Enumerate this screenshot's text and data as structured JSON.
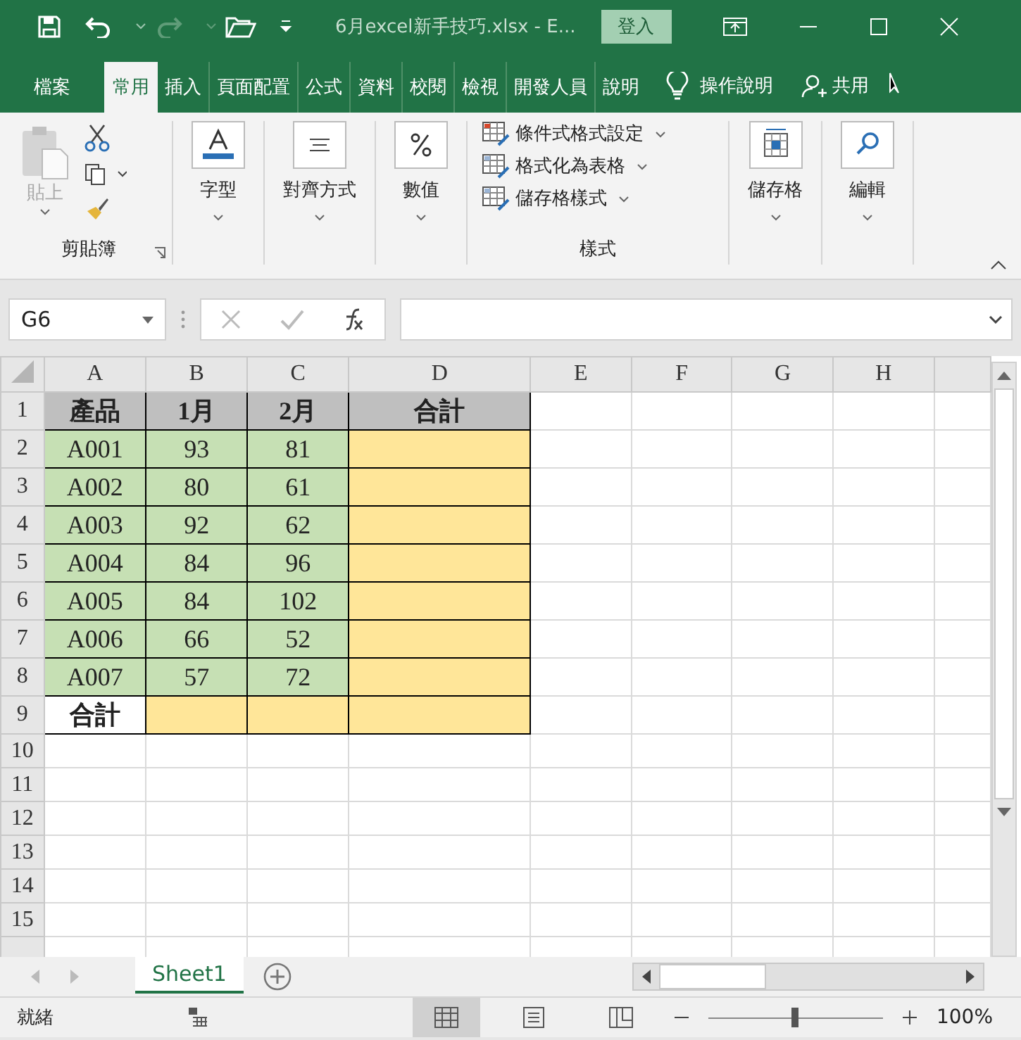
{
  "title_bar": {
    "title": "6月excel新手技巧.xlsx  -  E...",
    "sign_in": "登入"
  },
  "tabs": [
    {
      "label": "檔案",
      "selected": false
    },
    {
      "label": "常用",
      "selected": true
    },
    {
      "label": "插入",
      "selected": false
    },
    {
      "label": "頁面配置",
      "selected": false
    },
    {
      "label": "公式",
      "selected": false
    },
    {
      "label": "資料",
      "selected": false
    },
    {
      "label": "校閱",
      "selected": false
    },
    {
      "label": "檢視",
      "selected": false
    },
    {
      "label": "開發人員",
      "selected": false
    },
    {
      "label": "說明",
      "selected": false
    }
  ],
  "tell_me": "操作說明",
  "share": "共用",
  "ribbon": {
    "clipboard": {
      "paste": "貼上",
      "label": "剪貼簿"
    },
    "font": "字型",
    "alignment": "對齊方式",
    "number": "數值",
    "styles": {
      "items": [
        "條件式格式設定",
        "格式化為表格",
        "儲存格樣式"
      ],
      "label": "樣式"
    },
    "cells": "儲存格",
    "editing": "編輯"
  },
  "formula_bar": {
    "name_box": "G6"
  },
  "grid": {
    "columns": [
      "A",
      "B",
      "C",
      "D",
      "E",
      "F",
      "G",
      "H"
    ],
    "rows": [
      {
        "number": "1",
        "cells": [
          {
            "text": "產品",
            "color": "#bfbfbf",
            "bold": true
          },
          {
            "text": "1月",
            "color": "#bfbfbf",
            "bold": true
          },
          {
            "text": "2月",
            "color": "#bfbfbf",
            "bold": true
          },
          {
            "text": "合計",
            "color": "#bfbfbf",
            "bold": true
          }
        ]
      },
      {
        "number": "2",
        "cells": [
          {
            "text": "A001",
            "color": "#c6e0b4",
            "bold": false
          },
          {
            "text": "93",
            "color": "#c6e0b4",
            "bold": false
          },
          {
            "text": "81",
            "color": "#c6e0b4",
            "bold": false
          },
          {
            "color": "#ffe699"
          }
        ]
      },
      {
        "number": "3",
        "cells": [
          {
            "text": "A002",
            "color": "#c6e0b4",
            "bold": false
          },
          {
            "text": "80",
            "color": "#c6e0b4",
            "bold": false
          },
          {
            "text": "61",
            "color": "#c6e0b4",
            "bold": false
          },
          {
            "color": "#ffe699"
          }
        ]
      },
      {
        "number": "4",
        "cells": [
          {
            "text": "A003",
            "color": "#c6e0b4",
            "bold": false
          },
          {
            "text": "92",
            "color": "#c6e0b4",
            "bold": false
          },
          {
            "text": "62",
            "color": "#c6e0b4",
            "bold": false
          },
          {
            "color": "#ffe699"
          }
        ]
      },
      {
        "number": "5",
        "cells": [
          {
            "text": "A004",
            "color": "#c6e0b4",
            "bold": false
          },
          {
            "text": "84",
            "color": "#c6e0b4",
            "bold": false
          },
          {
            "text": "96",
            "color": "#c6e0b4",
            "bold": false
          },
          {
            "color": "#ffe699"
          }
        ]
      },
      {
        "number": "6",
        "cells": [
          {
            "text": "A005",
            "color": "#c6e0b4",
            "bold": false
          },
          {
            "text": "84",
            "color": "#c6e0b4",
            "bold": false
          },
          {
            "text": "102",
            "color": "#c6e0b4",
            "bold": false
          },
          {
            "color": "#ffe699"
          }
        ]
      },
      {
        "number": "7",
        "cells": [
          {
            "text": "A006",
            "color": "#c6e0b4",
            "bold": false
          },
          {
            "text": "66",
            "color": "#c6e0b4",
            "bold": false
          },
          {
            "text": "52",
            "color": "#c6e0b4",
            "bold": false
          },
          {
            "color": "#ffe699"
          }
        ]
      },
      {
        "number": "8",
        "cells": [
          {
            "text": "A007",
            "color": "#c6e0b4",
            "bold": false
          },
          {
            "text": "57",
            "color": "#c6e0b4",
            "bold": false
          },
          {
            "text": "72",
            "color": "#c6e0b4",
            "bold": false
          },
          {
            "color": "#ffe699"
          }
        ]
      },
      {
        "number": "9",
        "cells": [
          {
            "text": "合計",
            "color": "#ffffff",
            "bold": true
          },
          {
            "color": "#ffe699"
          },
          {
            "color": "#ffe699"
          },
          {
            "color": "#ffe699"
          }
        ]
      },
      {
        "number": "10",
        "cells": []
      },
      {
        "number": "11",
        "cells": []
      },
      {
        "number": "12",
        "cells": []
      },
      {
        "number": "13",
        "cells": []
      },
      {
        "number": "14",
        "cells": []
      },
      {
        "number": "15",
        "cells": []
      }
    ]
  },
  "sheet_tabs": [
    {
      "label": "Sheet1",
      "selected": true
    }
  ],
  "status_bar": {
    "status": "就緒",
    "views": [
      {
        "kind": "normal",
        "selected": true
      },
      {
        "kind": "page-layout",
        "selected": false
      },
      {
        "kind": "page-break",
        "selected": false
      }
    ],
    "zoom": {
      "level": 0.5,
      "reading": "100%"
    }
  }
}
